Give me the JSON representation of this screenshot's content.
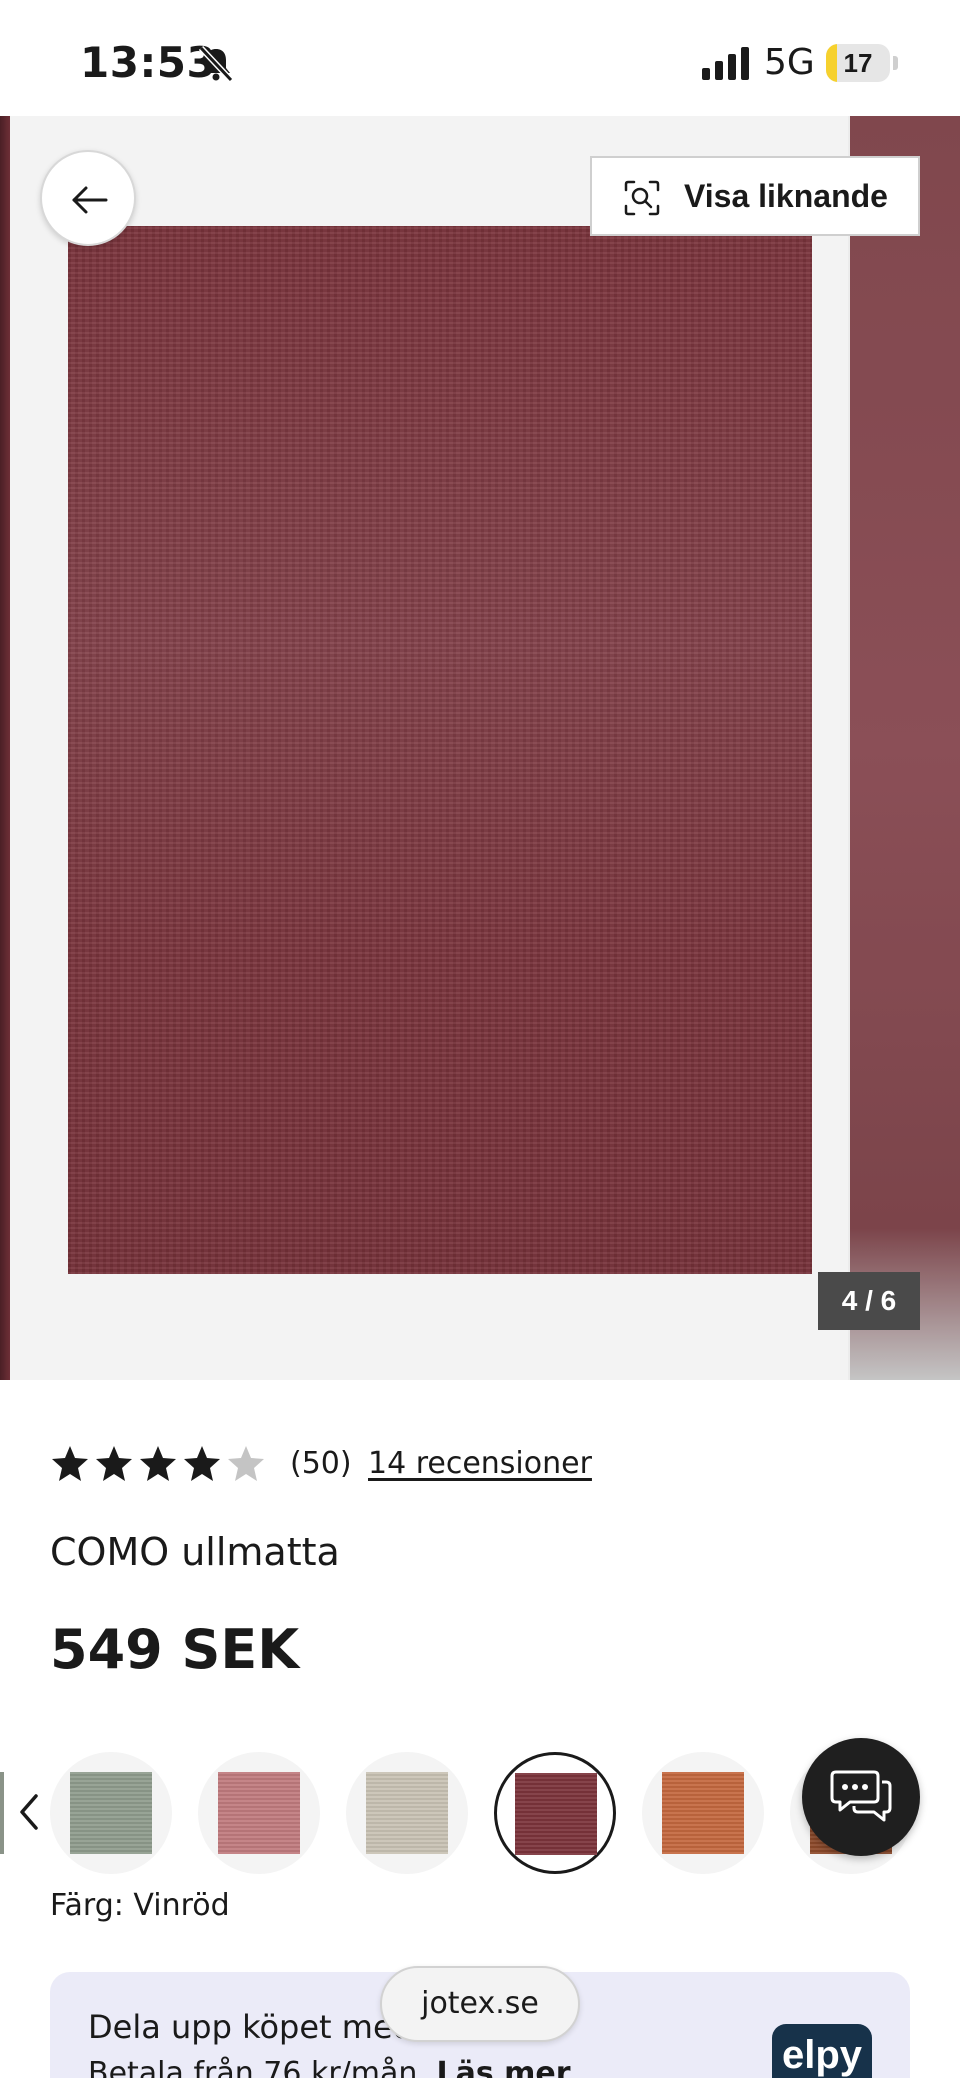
{
  "status_bar": {
    "time": "13:53",
    "network": "5G",
    "battery_level": "17",
    "battery_fraction": 0.17
  },
  "gallery": {
    "similar_label": "Visa liknande",
    "counter": "4 / 6",
    "rug_color": "#7c343c"
  },
  "product": {
    "rating": 4,
    "max_rating": 5,
    "rating_count": "(50)",
    "reviews_link": "14 recensioner",
    "title": "COMO ullmatta",
    "price": "549 SEK",
    "color_label": "Färg: Vinröd"
  },
  "swatches": [
    {
      "name": "green",
      "color": "#8f9c8d",
      "selected": false
    },
    {
      "name": "pink",
      "color": "#c07b7e",
      "selected": false
    },
    {
      "name": "beige",
      "color": "#c9c2b4",
      "selected": false
    },
    {
      "name": "wine-red",
      "color": "#7c343c",
      "selected": true
    },
    {
      "name": "orange",
      "color": "#c4683f",
      "selected": false
    },
    {
      "name": "brown",
      "color": "#8e4a2a",
      "selected": false
    }
  ],
  "payment": {
    "line1": "Dela upp köpet med",
    "line2": "Betala från 76 kr/mån.",
    "read_more": "Läs mer",
    "logo_text": "elpy"
  },
  "browser": {
    "domain": "jotex.se"
  },
  "icons": {
    "bell": "bell-slash-icon",
    "signal": "signal-bars-icon",
    "back": "arrow-left-icon",
    "similar": "visual-search-icon",
    "prev": "chevron-left-icon",
    "chat": "chat-bubbles-icon"
  }
}
